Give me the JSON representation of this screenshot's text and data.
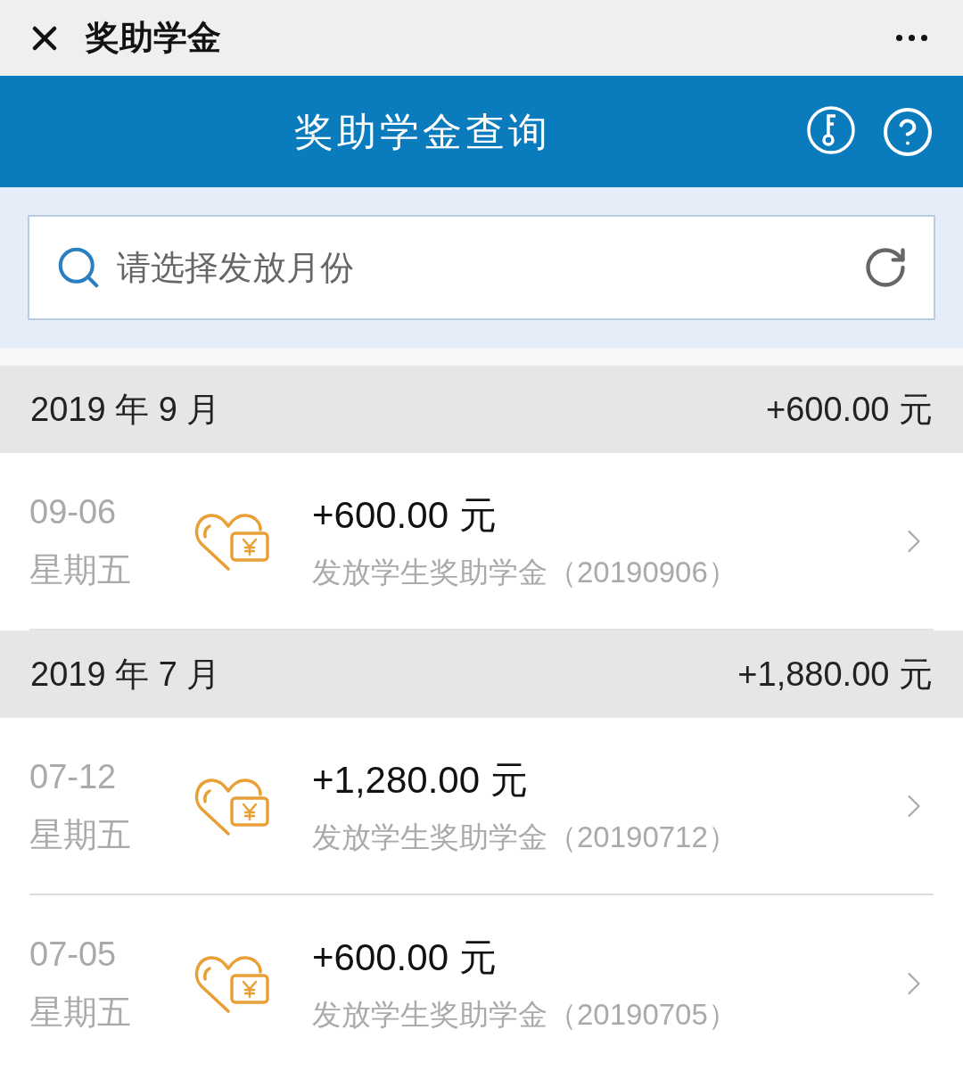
{
  "top_bar": {
    "title": "奖助学金"
  },
  "header": {
    "title": "奖助学金查询"
  },
  "search": {
    "placeholder": "请选择发放月份"
  },
  "groups": [
    {
      "month": "2019 年 9 月",
      "total": "+600.00 元",
      "items": [
        {
          "date": "09-06",
          "weekday": "星期五",
          "amount": "+600.00 元",
          "description": "发放学生奖助学金（20190906）"
        }
      ]
    },
    {
      "month": "2019 年 7 月",
      "total": "+1,880.00 元",
      "items": [
        {
          "date": "07-12",
          "weekday": "星期五",
          "amount": "+1,280.00 元",
          "description": "发放学生奖助学金（20190712）"
        },
        {
          "date": "07-05",
          "weekday": "星期五",
          "amount": "+600.00 元",
          "description": "发放学生奖助学金（20190705）"
        }
      ]
    }
  ]
}
